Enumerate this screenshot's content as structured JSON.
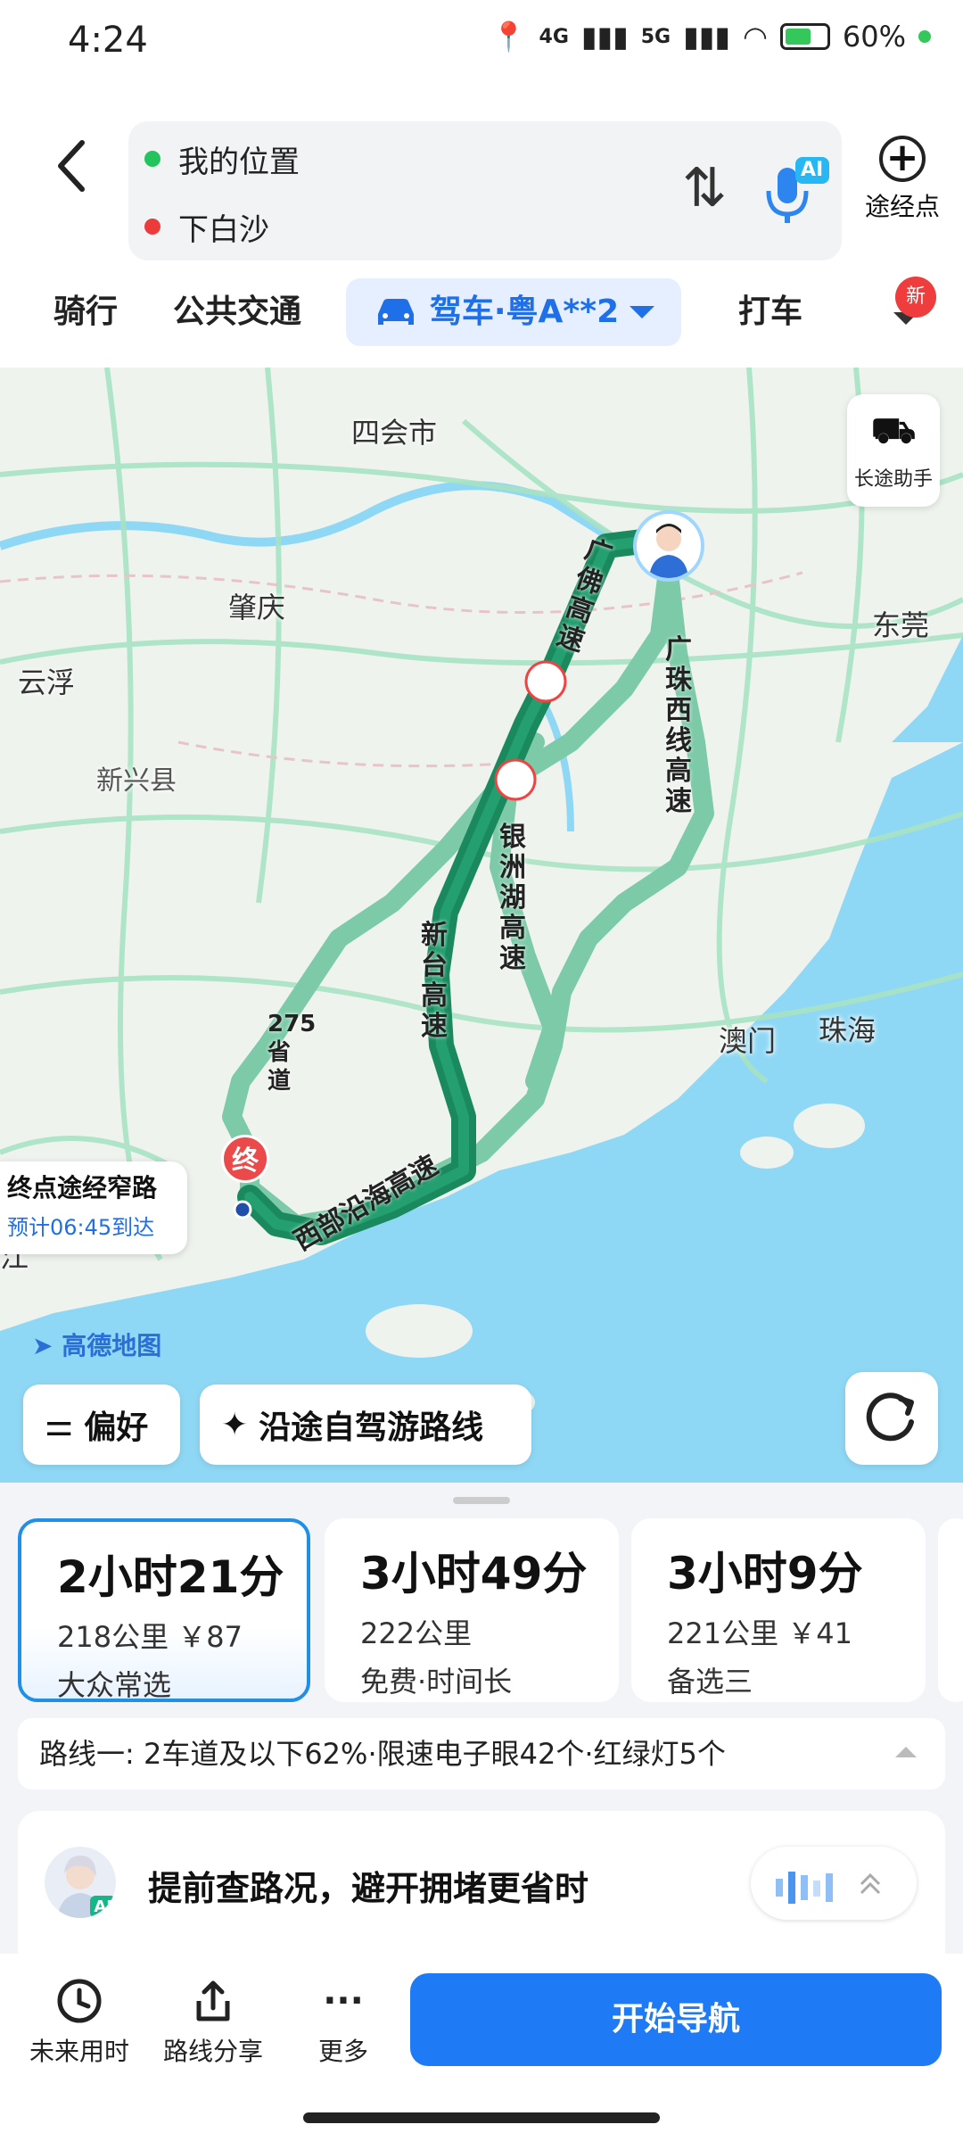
{
  "status_bar": {
    "time": "4:24",
    "net1": "4G",
    "net2": "5G",
    "battery": "60%"
  },
  "search": {
    "origin": "我的位置",
    "destination": "下白沙",
    "ai_badge": "AI",
    "waypoint_label": "途经点"
  },
  "modes": {
    "ride": "骑行",
    "transit": "公共交通",
    "drive": "驾车·粤A**2",
    "taxi": "打车",
    "new_badge": "新"
  },
  "map": {
    "cities": [
      "四会市",
      "肇庆",
      "云浮",
      "新兴县",
      "东莞",
      "澳门",
      "珠海"
    ],
    "roads": {
      "guangfo": "广佛高速",
      "guangzhu_west": "广珠西线高速",
      "yinzhouhu": "银洲湖高速",
      "xintai": "新台高速",
      "west_coast": "西部沿海高速",
      "provincial": "275省道"
    },
    "long_trip_label": "长途助手",
    "end_pin": "终",
    "end_title": "终点途经窄路",
    "end_eta": "预计06:45到达",
    "partial_city": "江",
    "logo_text": "高德地图",
    "pref_chip": "偏好",
    "trip_chip": "沿途自驾游路线"
  },
  "routes": [
    {
      "duration": "2小时21分",
      "meta": "218公里 ￥87",
      "tag": "大众常选",
      "selected": true
    },
    {
      "duration": "3小时49分",
      "meta": "222公里",
      "tag": "免费·时间长",
      "selected": false
    },
    {
      "duration": "3小时9分",
      "meta": "221公里 ￥41",
      "tag": "备选三",
      "selected": false
    }
  ],
  "route_info": "路线一: 2车道及以下62%·限速电子眼42个·红绿灯5个",
  "ai_card": {
    "text": "提前查路况，避开拥堵更省时",
    "badge": "AI"
  },
  "bottom": {
    "future": "未来用时",
    "share": "路线分享",
    "more": "更多",
    "start": "开始导航"
  },
  "colors": {
    "accent": "#1f7af5",
    "route_main": "#1a8a5e",
    "route_alt": "#7ccaa8",
    "sea": "#8fd8f5"
  }
}
